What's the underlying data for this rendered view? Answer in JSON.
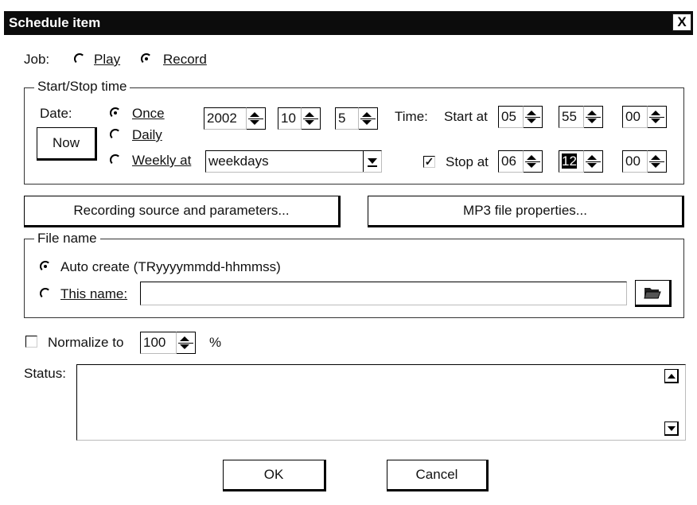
{
  "window": {
    "title": "Schedule item",
    "close_glyph": "X"
  },
  "job": {
    "label": "Job:",
    "options": [
      "Play",
      "Record"
    ],
    "selected": "Record"
  },
  "start_stop": {
    "legend": "Start/Stop time",
    "date_label": "Date:",
    "now_button": "Now",
    "recurrence": [
      "Once",
      "Daily",
      "Weekly at"
    ],
    "recurrence_selected": "Once",
    "weekly_value": "weekdays",
    "year": "2002",
    "month": "10",
    "day": "5",
    "time_label": "Time:",
    "start_label": "Start at",
    "start_hour": "05",
    "start_min": "55",
    "start_sec": "00",
    "stop_label": "Stop at",
    "stop_checked": true,
    "stop_hour": "06",
    "stop_min": "12",
    "stop_sec": "00"
  },
  "buttons": {
    "recording_source": "Recording source and parameters...",
    "mp3_props": "MP3 file properties...",
    "ok": "OK",
    "cancel": "Cancel"
  },
  "file_name": {
    "legend": "File name",
    "auto_create": "Auto create (TRyyyymmdd-hhmmss)",
    "this_name": "This name:",
    "this_name_value": "",
    "selected": "auto",
    "folder_icon": "folder-open-icon"
  },
  "normalize": {
    "label": "Normalize to",
    "value": "100",
    "unit": "%",
    "checked": false
  },
  "status": {
    "label": "Status:",
    "text": ""
  }
}
